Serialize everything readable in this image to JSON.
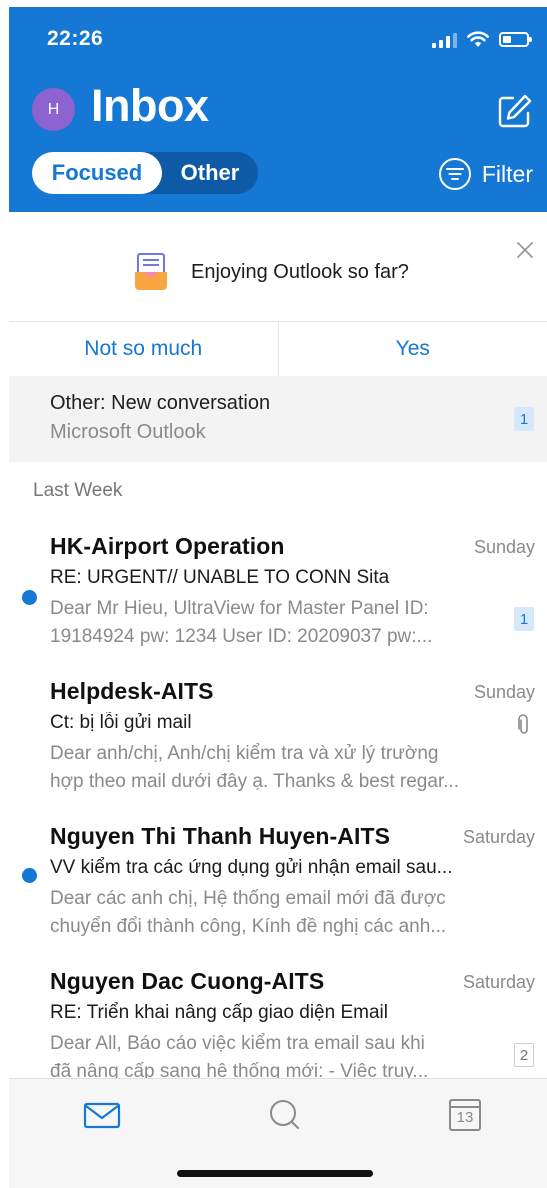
{
  "status": {
    "time": "22:26"
  },
  "header": {
    "avatar_initial": "H",
    "title": "Inbox",
    "tabs": {
      "focused": "Focused",
      "other": "Other"
    },
    "filter_label": "Filter"
  },
  "feedback": {
    "question": "Enjoying Outlook so far?",
    "no_label": "Not so much",
    "yes_label": "Yes"
  },
  "other_conversation": {
    "title": "Other: New conversation",
    "sender": "Microsoft Outlook",
    "count": "1"
  },
  "section": {
    "last_week": "Last Week"
  },
  "messages": [
    {
      "sender": "HK-Airport Operation",
      "date": "Sunday",
      "subject": "RE: URGENT// UNABLE TO CONN Sita",
      "preview1": "Dear Mr Hieu, UltraView for Master Panel ID:",
      "preview2": "19184924 pw: 1234 User ID: 20209037 pw:...",
      "unread": true,
      "count": "1"
    },
    {
      "sender": "Helpdesk-AITS",
      "date": "Sunday",
      "subject": "Ct: bị lỗi gửi mail",
      "preview1": "Dear anh/chị, Anh/chị kiểm tra và xử lý trường",
      "preview2": "hợp theo mail dưới đây ạ. Thanks & best regar...",
      "unread": false,
      "attachment": true
    },
    {
      "sender": "Nguyen Thi Thanh Huyen-AITS",
      "date": "Saturday",
      "subject": "VV kiểm tra các ứng dụng gửi nhận email sau...",
      "preview1": "Dear các anh chị, Hệ thống email mới đã được",
      "preview2": "chuyển đổi thành công, Kính đề nghị các anh...",
      "unread": true
    },
    {
      "sender": "Nguyen Dac Cuong-AITS",
      "date": "Saturday",
      "subject": "RE: Triển khai nâng cấp giao diện Email",
      "preview1": "Dear All, Báo cáo việc kiểm tra email sau khi",
      "preview2": "đã nâng cấp sang hệ thống mới: - Việc truy...",
      "unread": false,
      "count": "2"
    }
  ],
  "tabbar": {
    "calendar_day": "13"
  },
  "colors": {
    "accent": "#1478d4",
    "avatar": "#8d63cf",
    "muted": "#8a8a8a"
  }
}
